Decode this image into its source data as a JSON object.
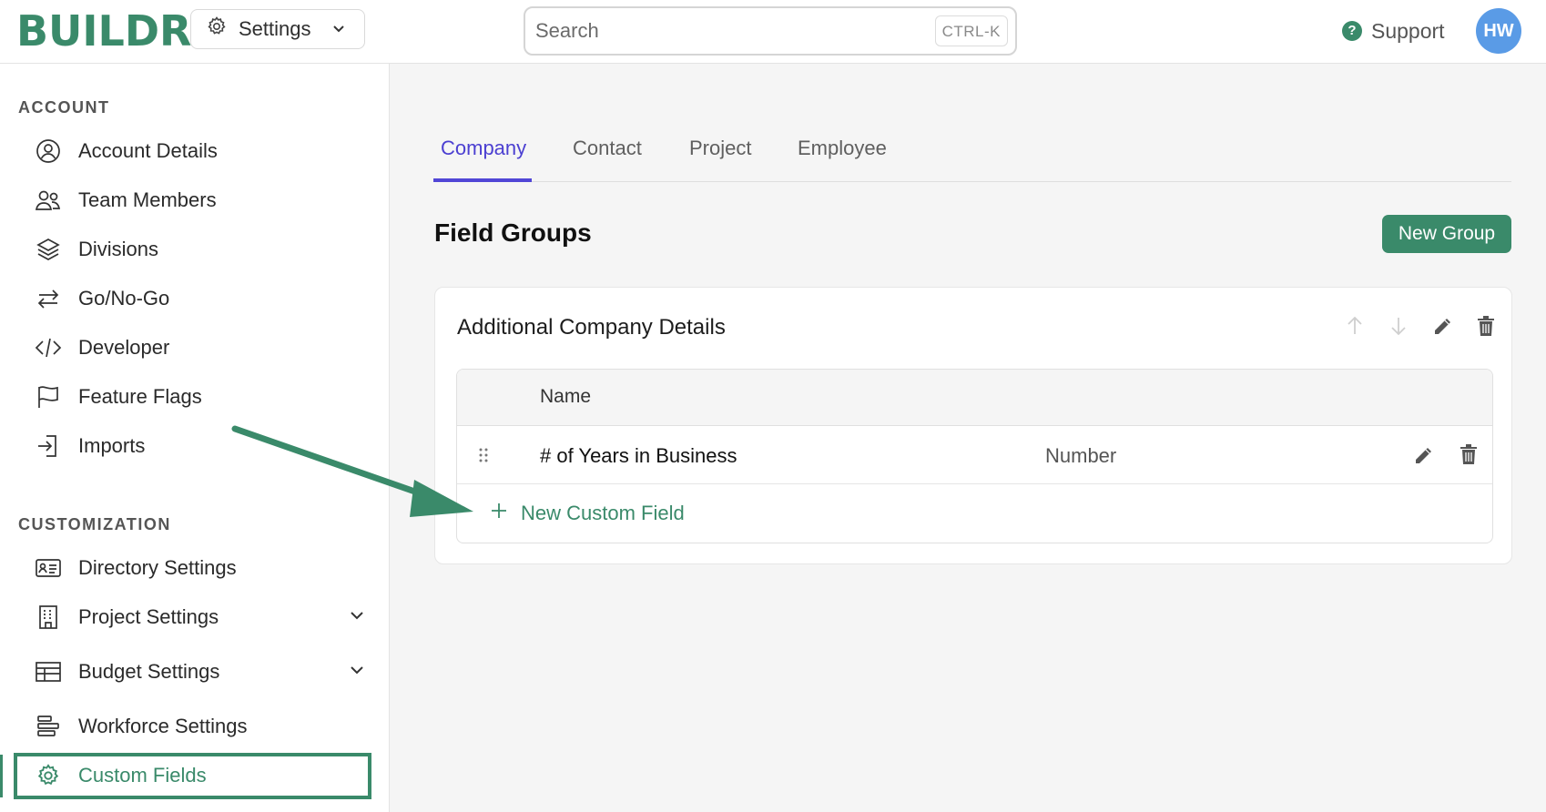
{
  "header": {
    "logo": "BUILDR",
    "settings_label": "Settings",
    "search_placeholder": "Search",
    "search_shortcut": "CTRL-K",
    "support_label": "Support",
    "avatar_initials": "HW"
  },
  "sidebar": {
    "account_title": "ACCOUNT",
    "account_items": [
      {
        "label": "Account Details",
        "icon": "user-circle-icon"
      },
      {
        "label": "Team Members",
        "icon": "users-icon"
      },
      {
        "label": "Divisions",
        "icon": "layers-icon"
      },
      {
        "label": "Go/No-Go",
        "icon": "arrows-exchange-icon"
      },
      {
        "label": "Developer",
        "icon": "code-icon"
      },
      {
        "label": "Feature Flags",
        "icon": "flag-icon"
      },
      {
        "label": "Imports",
        "icon": "import-icon"
      }
    ],
    "customization_title": "CUSTOMIZATION",
    "customization_items": [
      {
        "label": "Directory Settings",
        "icon": "id-card-icon"
      },
      {
        "label": "Project Settings",
        "icon": "building-icon"
      },
      {
        "label": "Budget Settings",
        "icon": "table-icon"
      },
      {
        "label": "Workforce Settings",
        "icon": "workforce-icon"
      },
      {
        "label": "Custom Fields",
        "icon": "gear-icon"
      }
    ]
  },
  "main": {
    "tabs": [
      "Company",
      "Contact",
      "Project",
      "Employee"
    ],
    "active_tab": "Company",
    "section_title": "Field Groups",
    "new_group_label": "New Group",
    "group": {
      "title": "Additional Company Details",
      "column_name": "Name",
      "fields": [
        {
          "name": "# of Years in Business",
          "type": "Number"
        }
      ],
      "new_field_label": "New Custom Field"
    }
  },
  "colors": {
    "brand_green": "#3a8a6a",
    "active_tab": "#4b3fd1",
    "avatar_blue": "#5a9be6"
  }
}
